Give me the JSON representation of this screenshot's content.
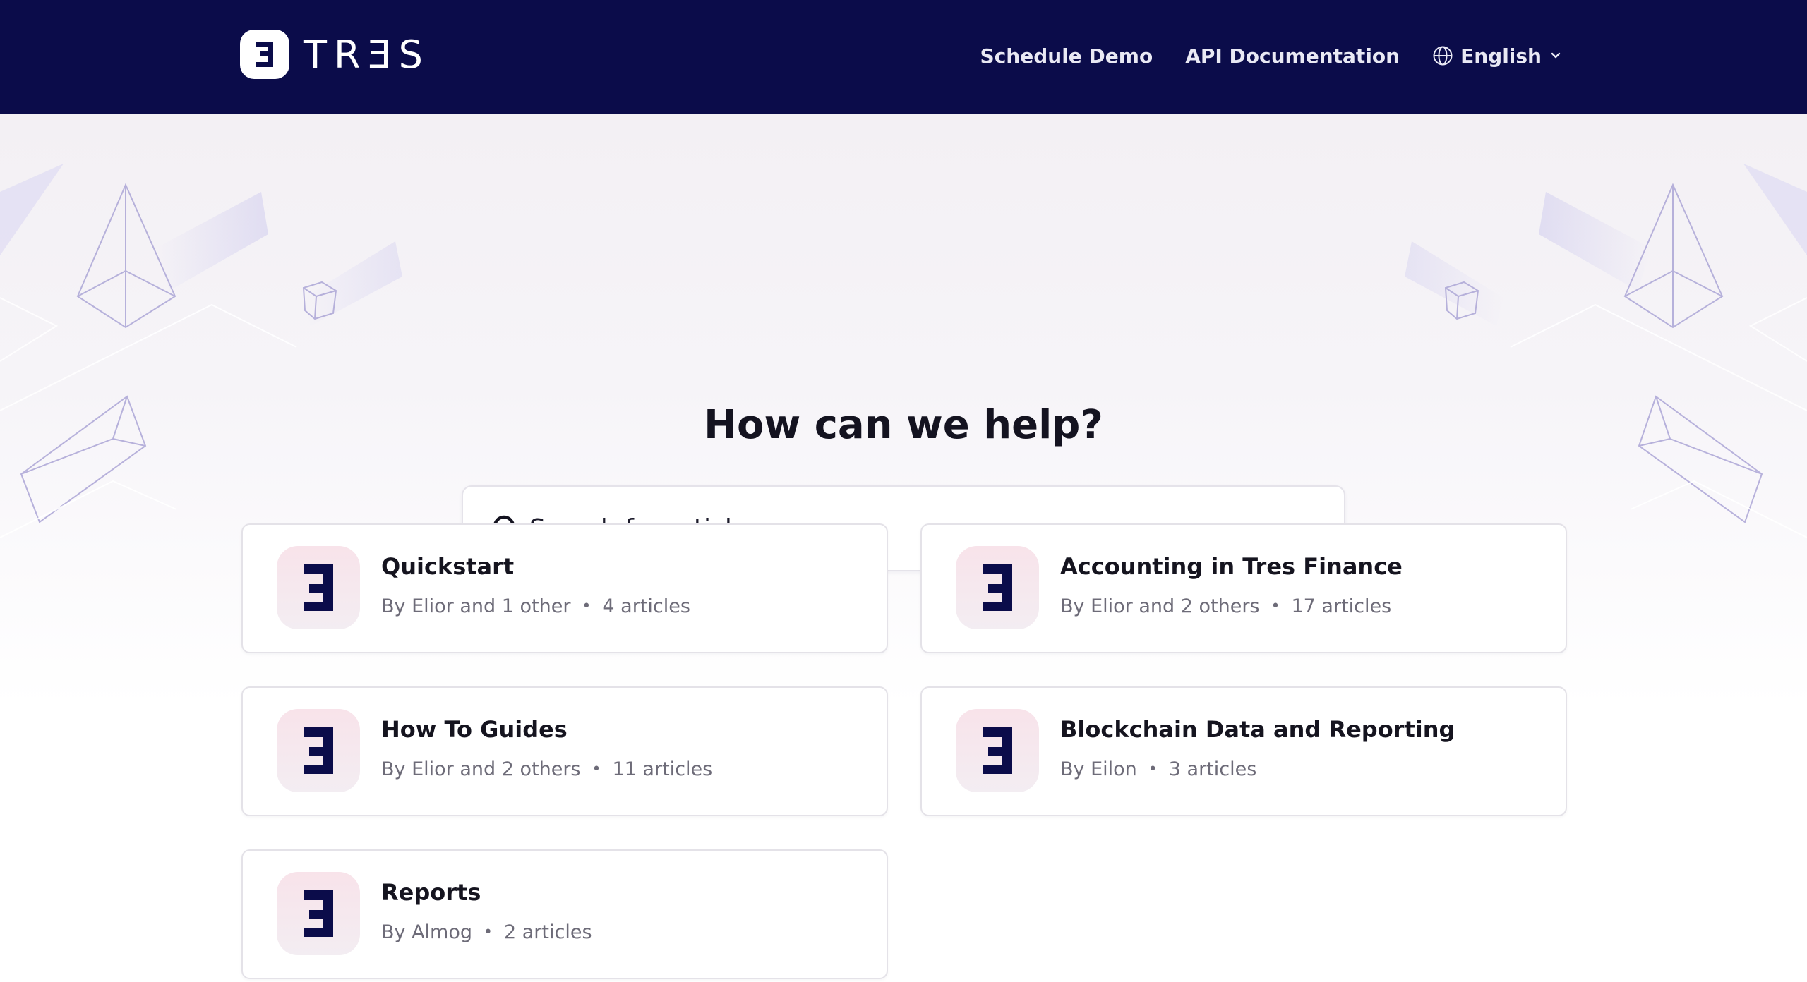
{
  "header": {
    "brand_name": "TRƎS",
    "nav": {
      "schedule_demo": "Schedule Demo",
      "api_docs": "API Documentation",
      "language": "English"
    },
    "background_color": "#0b0c4a"
  },
  "hero": {
    "title": "How can we help?",
    "search": {
      "placeholder": "Search for articles..."
    }
  },
  "collections": [
    {
      "title": "Quickstart",
      "authors": "By Elior and 1 other",
      "article_count": "4 articles",
      "icon": "tres-logo-icon"
    },
    {
      "title": "Accounting in Tres Finance",
      "authors": "By Elior and 2 others",
      "article_count": "17 articles",
      "icon": "tres-logo-icon"
    },
    {
      "title": "How To Guides",
      "authors": "By Elior and 2 others",
      "article_count": "11 articles",
      "icon": "tres-logo-icon"
    },
    {
      "title": "Blockchain Data and Reporting",
      "authors": "By Eilon",
      "article_count": "3 articles",
      "icon": "tres-logo-icon"
    },
    {
      "title": "Reports",
      "authors": "By Almog",
      "article_count": "2 articles",
      "icon": "tres-logo-icon"
    }
  ],
  "colors": {
    "accent": "#0b0c4a",
    "icon_tile": "#f6e6ec",
    "meta_text": "#6d6b78"
  }
}
